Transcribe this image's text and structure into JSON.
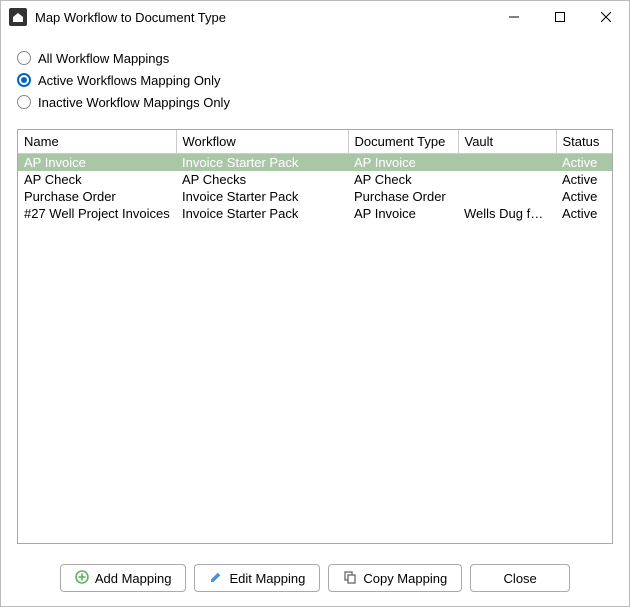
{
  "window": {
    "title": "Map Workflow to Document Type"
  },
  "filters": {
    "options": [
      {
        "label": "All Workflow Mappings",
        "selected": false
      },
      {
        "label": "Active Workflows Mapping Only",
        "selected": true
      },
      {
        "label": "Inactive Workflow Mappings Only",
        "selected": false
      }
    ]
  },
  "table": {
    "headers": {
      "name": "Name",
      "workflow": "Workflow",
      "doctype": "Document Type",
      "vault": "Vault",
      "status": "Status"
    },
    "rows": [
      {
        "name": "AP Invoice",
        "workflow": "Invoice Starter Pack",
        "doctype": "AP Invoice",
        "vault": "",
        "status": "Active",
        "selected": true
      },
      {
        "name": "AP Check",
        "workflow": "AP Checks",
        "doctype": "AP Check",
        "vault": "",
        "status": "Active",
        "selected": false
      },
      {
        "name": "Purchase Order",
        "workflow": "Invoice Starter Pack",
        "doctype": "Purchase Order",
        "vault": "",
        "status": "Active",
        "selected": false
      },
      {
        "name": "#27 Well Project Invoices",
        "workflow": "Invoice Starter Pack",
        "doctype": "AP Invoice",
        "vault": "Wells Dug for ...",
        "status": "Active",
        "selected": false
      }
    ]
  },
  "buttons": {
    "add": "Add Mapping",
    "edit": "Edit Mapping",
    "copy": "Copy Mapping",
    "close": "Close"
  },
  "colors": {
    "accent": "#0067c0",
    "row_selected_bg": "#a9c7a6",
    "icon_add": "#5fb35f",
    "icon_edit": "#4a90d9",
    "icon_copy": "#666666"
  }
}
